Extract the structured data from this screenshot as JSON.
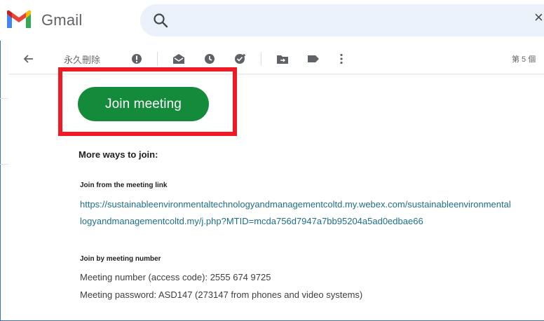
{
  "app": {
    "name": "Gmail"
  },
  "colors": {
    "accent_green": "#138b3a",
    "highlight_red": "#ee1b24",
    "link_color": "#1f6f8b",
    "search_bg": "#eaf1fb"
  },
  "header": {
    "search_close": "×"
  },
  "toolbar": {
    "delete_forever_label": "永久刪除",
    "page_indicator": "第 5 個",
    "icons": [
      "back-arrow-icon",
      "report-spam-icon",
      "mark-unread-icon",
      "snooze-icon",
      "add-to-tasks-icon",
      "move-to-icon",
      "label-icon",
      "more-vert-icon"
    ]
  },
  "email": {
    "join_button_label": "Join meeting",
    "more_ways_heading": "More ways to join:",
    "link_section_heading": "Join from the meeting link",
    "link_line_1": "https://sustainableenvironmentaltechnologyandmanagementcoltd.my.webex.com/sustainableenvironmental",
    "link_line_2": "logyandmanagementcoltd.my/j.php?MTID=mcda756d7947a7bb95204a5ad0edbae66",
    "number_section_heading": "Join by meeting number",
    "meeting_number_line": "Meeting number (access code): 2555 674 9725",
    "meeting_password_line": "Meeting password: ASD147 (273147 from phones and video systems)"
  }
}
